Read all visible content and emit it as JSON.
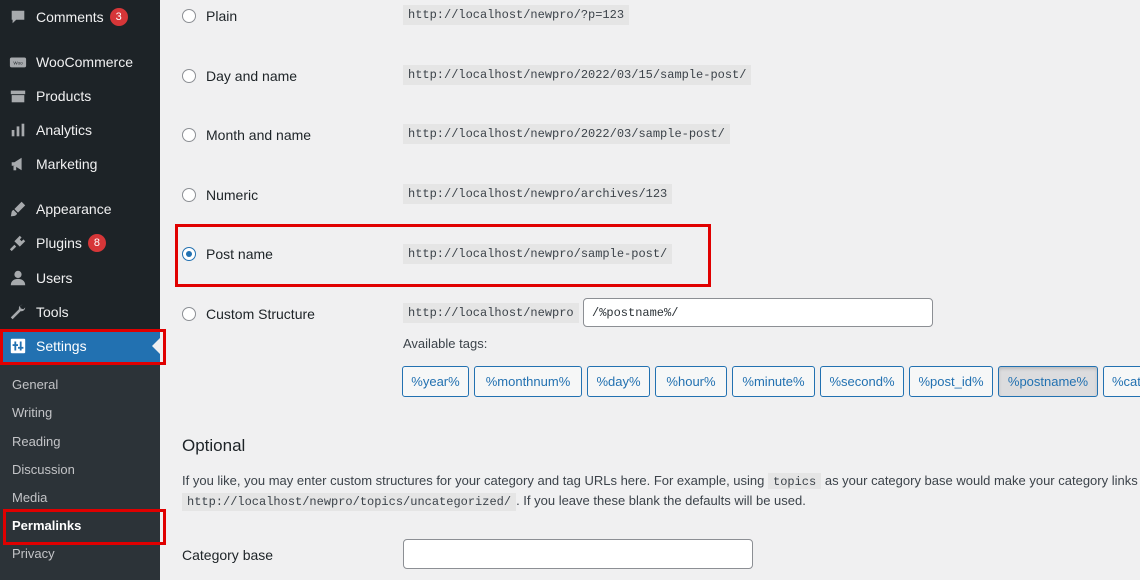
{
  "sidebar": {
    "items": [
      {
        "label": "Comments",
        "icon": "comment-icon",
        "badge": "3"
      },
      {
        "label": "WooCommerce",
        "icon": "woo-icon"
      },
      {
        "label": "Products",
        "icon": "archive-icon"
      },
      {
        "label": "Analytics",
        "icon": "bar-chart-icon"
      },
      {
        "label": "Marketing",
        "icon": "megaphone-icon"
      },
      {
        "label": "Appearance",
        "icon": "paintbrush-icon"
      },
      {
        "label": "Plugins",
        "icon": "plug-icon",
        "badge": "8"
      },
      {
        "label": "Users",
        "icon": "user-icon"
      },
      {
        "label": "Tools",
        "icon": "wrench-icon"
      },
      {
        "label": "Settings",
        "icon": "settings-icon"
      }
    ],
    "submenu": [
      "General",
      "Writing",
      "Reading",
      "Discussion",
      "Media",
      "Permalinks",
      "Privacy"
    ],
    "woo_icon_text": "Woo"
  },
  "permalinks": {
    "options": [
      {
        "label": "Plain",
        "example": "http://localhost/newpro/?p=123"
      },
      {
        "label": "Day and name",
        "example": "http://localhost/newpro/2022/03/15/sample-post/"
      },
      {
        "label": "Month and name",
        "example": "http://localhost/newpro/2022/03/sample-post/"
      },
      {
        "label": "Numeric",
        "example": "http://localhost/newpro/archives/123"
      },
      {
        "label": "Post name",
        "example": "http://localhost/newpro/sample-post/"
      },
      {
        "label": "Custom Structure",
        "prefix": "http://localhost/newpro",
        "value": "/%postname%/"
      }
    ],
    "selected": "Post name",
    "available_tags_label": "Available tags:",
    "tags": [
      "%year%",
      "%monthnum%",
      "%day%",
      "%hour%",
      "%minute%",
      "%second%",
      "%post_id%",
      "%postname%",
      "%cat"
    ]
  },
  "optional": {
    "title": "Optional",
    "desc_1": "If you like, you may enter custom structures for your category and tag URLs here. For example, using",
    "desc_code_1": "topics",
    "desc_2": "as your category base would make your category links li",
    "desc_code_2": "http://localhost/newpro/topics/uncategorized/",
    "desc_3": ". If you leave these blank the defaults will be used.",
    "category_base_label": "Category base",
    "category_base_value": ""
  },
  "colors": {
    "accent": "#2271b1",
    "sidebar": "#1d2327",
    "highlight": "#e00000",
    "badge": "#d63638"
  }
}
